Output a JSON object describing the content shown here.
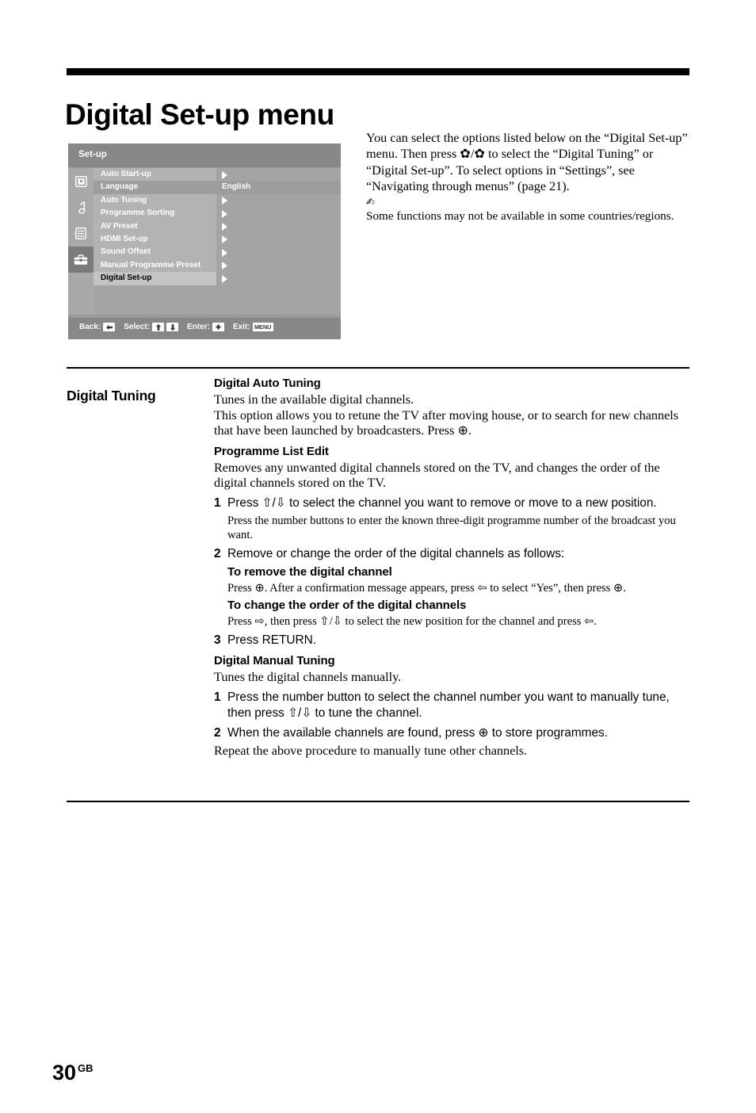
{
  "page": {
    "title": "Digital Set-up menu",
    "folio_number": "30",
    "folio_region": "GB"
  },
  "osd": {
    "header_label": "Set-up",
    "sidebar_icons": [
      {
        "name": "picture-icon",
        "active": false
      },
      {
        "name": "sound-note-icon",
        "active": false
      },
      {
        "name": "features-list-icon",
        "active": false
      },
      {
        "name": "setup-toolbox-icon",
        "active": true
      }
    ],
    "rows": [
      {
        "label": "Auto Start-up",
        "arrow": true,
        "value": "",
        "selected": false,
        "valuerow": false
      },
      {
        "label": "Language",
        "arrow": false,
        "value": "English",
        "selected": false,
        "valuerow": true
      },
      {
        "label": "Auto Tuning",
        "arrow": true,
        "value": "",
        "selected": false,
        "valuerow": false
      },
      {
        "label": "Programme Sorting",
        "arrow": true,
        "value": "",
        "selected": false,
        "valuerow": false
      },
      {
        "label": "AV Preset",
        "arrow": true,
        "value": "",
        "selected": false,
        "valuerow": false
      },
      {
        "label": "HDMI Set-up",
        "arrow": true,
        "value": "",
        "selected": false,
        "valuerow": false
      },
      {
        "label": "Sound Offset",
        "arrow": true,
        "value": "",
        "selected": false,
        "valuerow": false
      },
      {
        "label": "Manual Programme Preset",
        "arrow": true,
        "value": "",
        "selected": false,
        "valuerow": false
      },
      {
        "label": "Digital Set-up",
        "arrow": true,
        "value": "",
        "selected": true,
        "valuerow": false
      }
    ],
    "footer": {
      "back_label": "Back:",
      "select_label": "Select:",
      "enter_label": "Enter:",
      "exit_label": "Exit:",
      "exit_key": "MENU"
    },
    "colors": {
      "header_bg": "#878789",
      "body_bg": "#a4a4a6",
      "row_bg": "#b3b3b5",
      "row_selected_bg": "#c3c3c5",
      "value_row_bg": "#9d9d9f",
      "sidebar_active_bg": "#7b7b7d"
    }
  },
  "intro": {
    "paragraph": "You can select the options listed below on the “Digital Set-up” menu. Then press ✿/✿ to select the “Digital Tuning” or “Digital Set-up”. To select options in “Settings”, see “Navigating through menus” (page 21).",
    "note": "Some functions may not be available in some countries/regions."
  },
  "section": {
    "heading": "Digital Tuning",
    "auto_tuning": {
      "heading": "Digital Auto Tuning",
      "line1": "Tunes in the available digital channels.",
      "line2": "This option allows you to retune the TV after moving house, or to search for new channels that have been launched by broadcasters. Press ⊕."
    },
    "programme_list_edit": {
      "heading": "Programme List Edit",
      "description": "Removes any unwanted digital channels stored on the TV, and changes the order of the digital channels stored on the TV.",
      "step1_num": "1",
      "step1_text": "Press ⇧/⇩ to select the channel you want to remove or move to a new position.",
      "step1_note": "Press the number buttons to enter the known three-digit programme number of the broadcast you want.",
      "step2_num": "2",
      "step2_text": "Remove or change the order of the digital channels as follows:",
      "remove_heading": "To remove the digital channel",
      "remove_text": "Press ⊕. After a confirmation message appears, press ⇦ to select “Yes”, then press ⊕.",
      "reorder_heading": "To change the order of the digital channels",
      "reorder_text": "Press ⇨, then press ⇧/⇩ to select the new position for the channel and press ⇦.",
      "step3_num": "3",
      "step3_text": "Press RETURN."
    },
    "manual_tuning": {
      "heading": "Digital Manual Tuning",
      "description": "Tunes the digital channels manually.",
      "step1_num": "1",
      "step1_text": "Press the number button to select the channel number you want to manually tune, then press ⇧/⇩ to tune the channel.",
      "step2_num": "2",
      "step2_text": "When the available channels are found, press ⊕ to store programmes.",
      "closing": "Repeat the above procedure to manually tune other channels."
    }
  }
}
